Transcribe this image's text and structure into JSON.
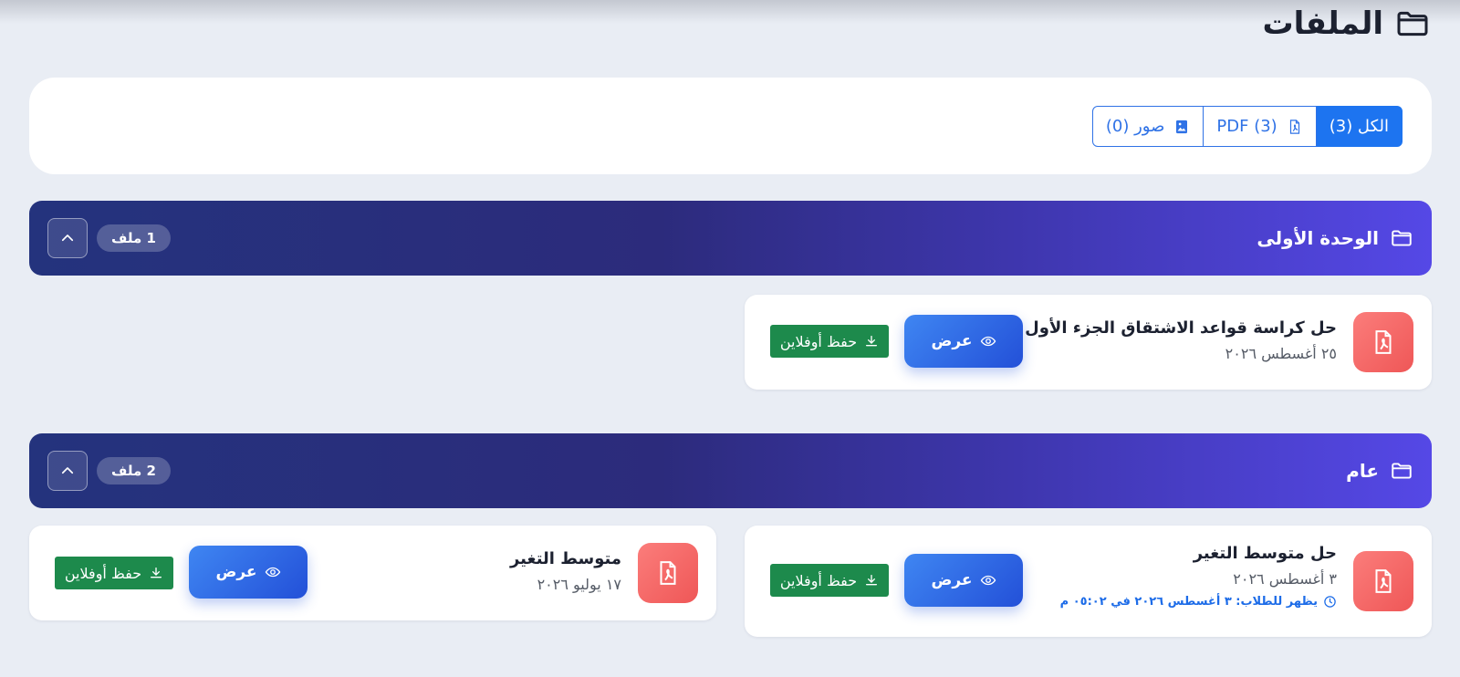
{
  "page": {
    "title": "الملفات"
  },
  "filters": [
    {
      "label": "الكل (3)",
      "active": true
    },
    {
      "label": "PDF (3)",
      "active": false
    },
    {
      "label": "صور (0)",
      "active": false
    }
  ],
  "sections": [
    {
      "title": "الوحدة الأولى",
      "count": "1 ملف",
      "files": [
        {
          "name": "حل كراسة قواعد الاشتقاق الجزء الأول",
          "date": "٢٥ أغسطس ٢٠٢٦",
          "note": ""
        }
      ]
    },
    {
      "title": "عام",
      "count": "2 ملف",
      "files": [
        {
          "name": "حل متوسط التغير",
          "date": "٣ أغسطس ٢٠٢٦",
          "note": "يظهر للطلاب: ٣ أغسطس ٢٠٢٦ في ٠٥:٠٢ م"
        },
        {
          "name": "متوسط التغير",
          "date": "١٧ يوليو ٢٠٢٦",
          "note": ""
        }
      ]
    }
  ],
  "actions": {
    "view": "عرض",
    "offline": "حفظ أوفلاين"
  },
  "colors": {
    "accent": "#1d74f0",
    "header_start": "#5548e6",
    "header_end": "#24337d",
    "pdf_tile": "#ef5757",
    "offline": "#1d8a4c"
  }
}
